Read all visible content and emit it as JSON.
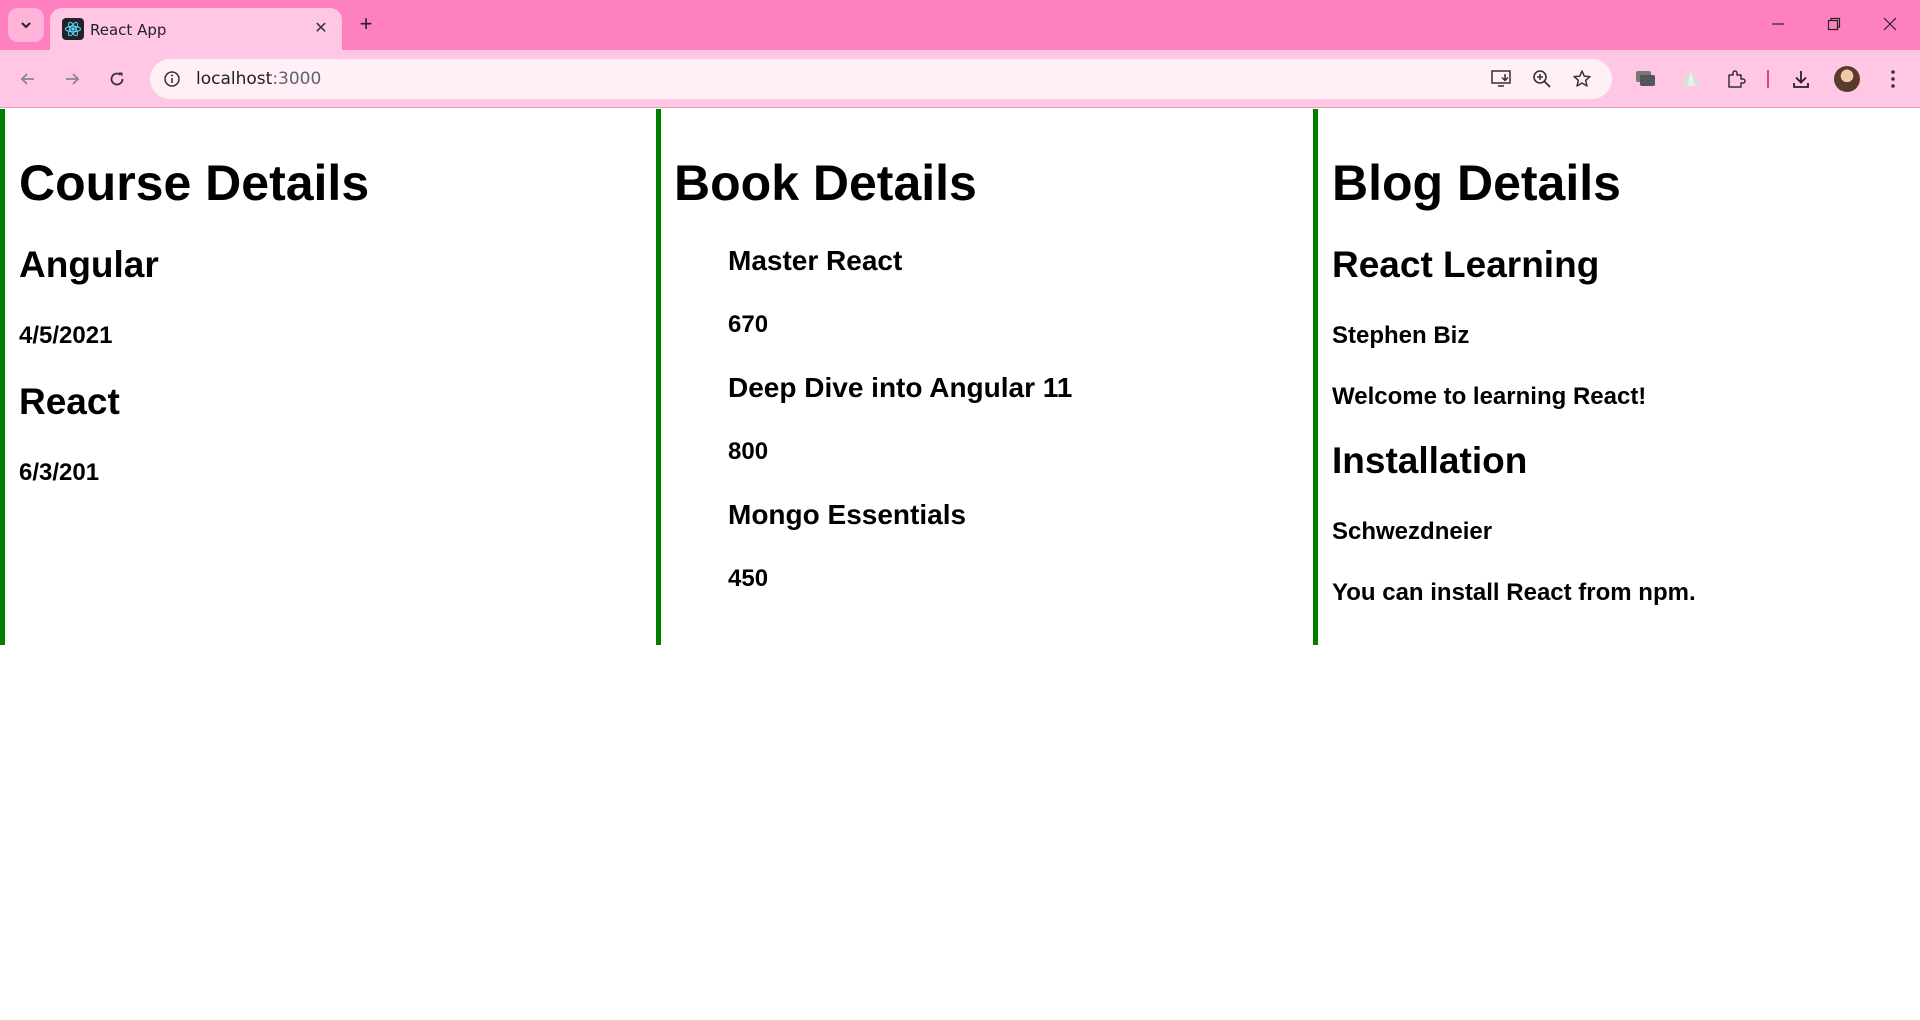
{
  "browser": {
    "tab_title": "React App",
    "url_host": "localhost",
    "url_port": ":3000"
  },
  "course": {
    "heading": "Course Details",
    "items": [
      {
        "name": "Angular",
        "date": "4/5/2021"
      },
      {
        "name": "React",
        "date": "6/3/201"
      }
    ]
  },
  "book": {
    "heading": "Book Details",
    "items": [
      {
        "name": "Master React",
        "price": "670"
      },
      {
        "name": "Deep Dive into Angular 11",
        "price": "800"
      },
      {
        "name": "Mongo Essentials",
        "price": "450"
      }
    ]
  },
  "blog": {
    "heading": "Blog Details",
    "items": [
      {
        "title": "React Learning",
        "author": "Stephen Biz",
        "content": "Welcome to learning React!"
      },
      {
        "title": "Installation",
        "author": "Schwezdneier",
        "content": "You can install React from npm."
      }
    ]
  },
  "colors": {
    "tab_strip": "#ff80bf",
    "toolbar": "#ffc7e3",
    "column_border": "#008000"
  }
}
